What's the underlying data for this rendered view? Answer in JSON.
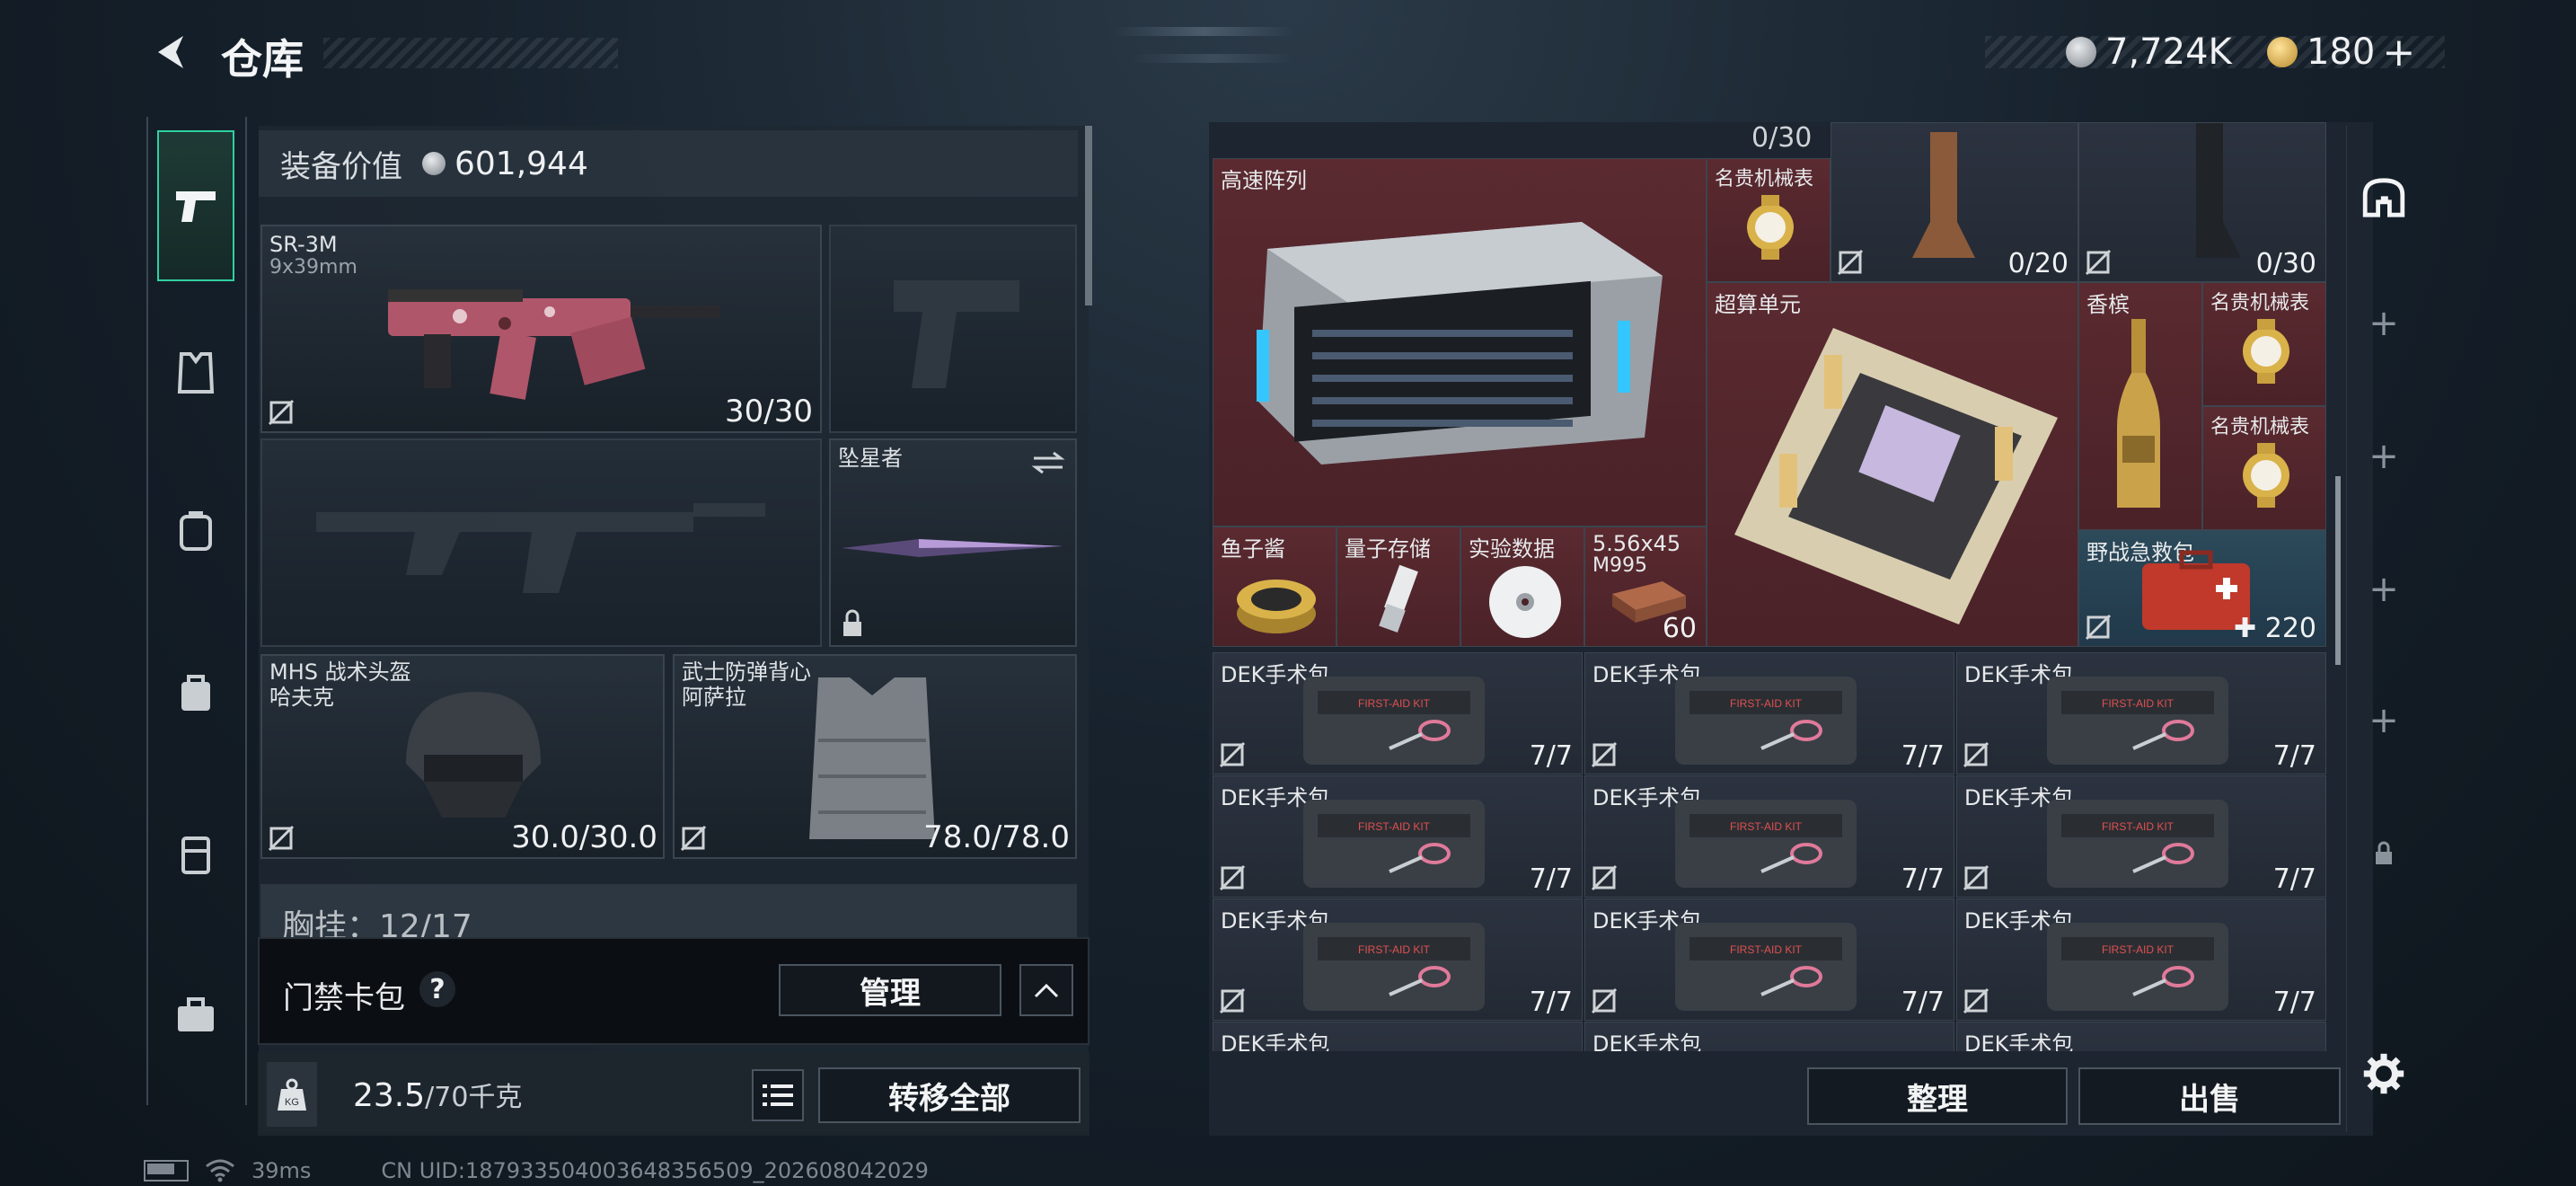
{
  "header": {
    "title": "仓库",
    "currency1": "7,724K",
    "currency2": "180",
    "plus": "+"
  },
  "loadout": {
    "value_label": "装备价值",
    "value": "601,944",
    "primary": {
      "name": "SR-3M",
      "ammo": "9x39mm",
      "count": "30/30"
    },
    "melee": {
      "name": "坠星者"
    },
    "helmet": {
      "name": "MHS 战术头盔",
      "sub": "哈夫克",
      "durability": "30.0/30.0"
    },
    "armor": {
      "name": "武士防弹背心",
      "sub": "阿萨拉",
      "durability": "78.0/78.0"
    },
    "chest_partial": "胸挂：12/17",
    "keycard_label": "门禁卡包",
    "help": "?",
    "manage": "管理",
    "weight": "23.5",
    "weight_max": "/70千克",
    "transfer_all": "转移全部",
    "weight_icon_text": "KG"
  },
  "inventory": {
    "top_count": "0/30",
    "items": {
      "array": "高速阵列",
      "watch1": "名贵机械表",
      "stock1_count": "0/20",
      "stock2_count": "0/30",
      "compute": "超算单元",
      "champagne": "香槟",
      "watch2": "名贵机械表",
      "watch3": "名贵机械表",
      "caviar": "鱼子酱",
      "qstorage": "量子存储",
      "data": "实验数据",
      "ammo_name": "5.56x45",
      "ammo_sub": "M995",
      "ammo_count": "60",
      "firstaid": "野战急救包",
      "firstaid_count": "220"
    },
    "dek_label": "DEK手术包",
    "dek_count": "7/7",
    "kit_text": "FIRST-AID KIT",
    "sort": "整理",
    "sell": "出售"
  },
  "status": {
    "ping": "39ms",
    "uid": "CN UID:187933504003648356509_202608042029"
  },
  "colors": {
    "accent_green": "#2fd0a0",
    "red_cell": "#5a2a30",
    "teal_cell": "#2c4a5a"
  }
}
